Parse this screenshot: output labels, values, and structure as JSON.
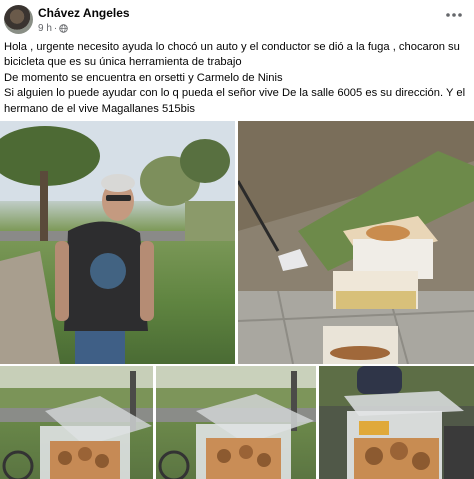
{
  "post": {
    "author": "Chávez Angeles",
    "time": "9 h",
    "separator": "·",
    "paragraphs": [
      "Hola , urgente necesito ayuda lo chocó un auto y el conductor se dió a la fuga , chocaron su",
      "bicicleta que es su  única herramienta de trabajo",
      "De momento se encuentra en  orsetti y Carmelo de Ninis",
      "Si alguien lo puede ayudar con lo q pueda el señor vive De la salle 6005 es su dirección. Y el",
      "hermano de el vive Magallanes 515bis"
    ]
  },
  "icons": {
    "privacy": "globe-icon",
    "options": "more-options-icon"
  },
  "colors": {
    "text": "#050505",
    "meta": "#65676b",
    "background": "#ffffff"
  }
}
